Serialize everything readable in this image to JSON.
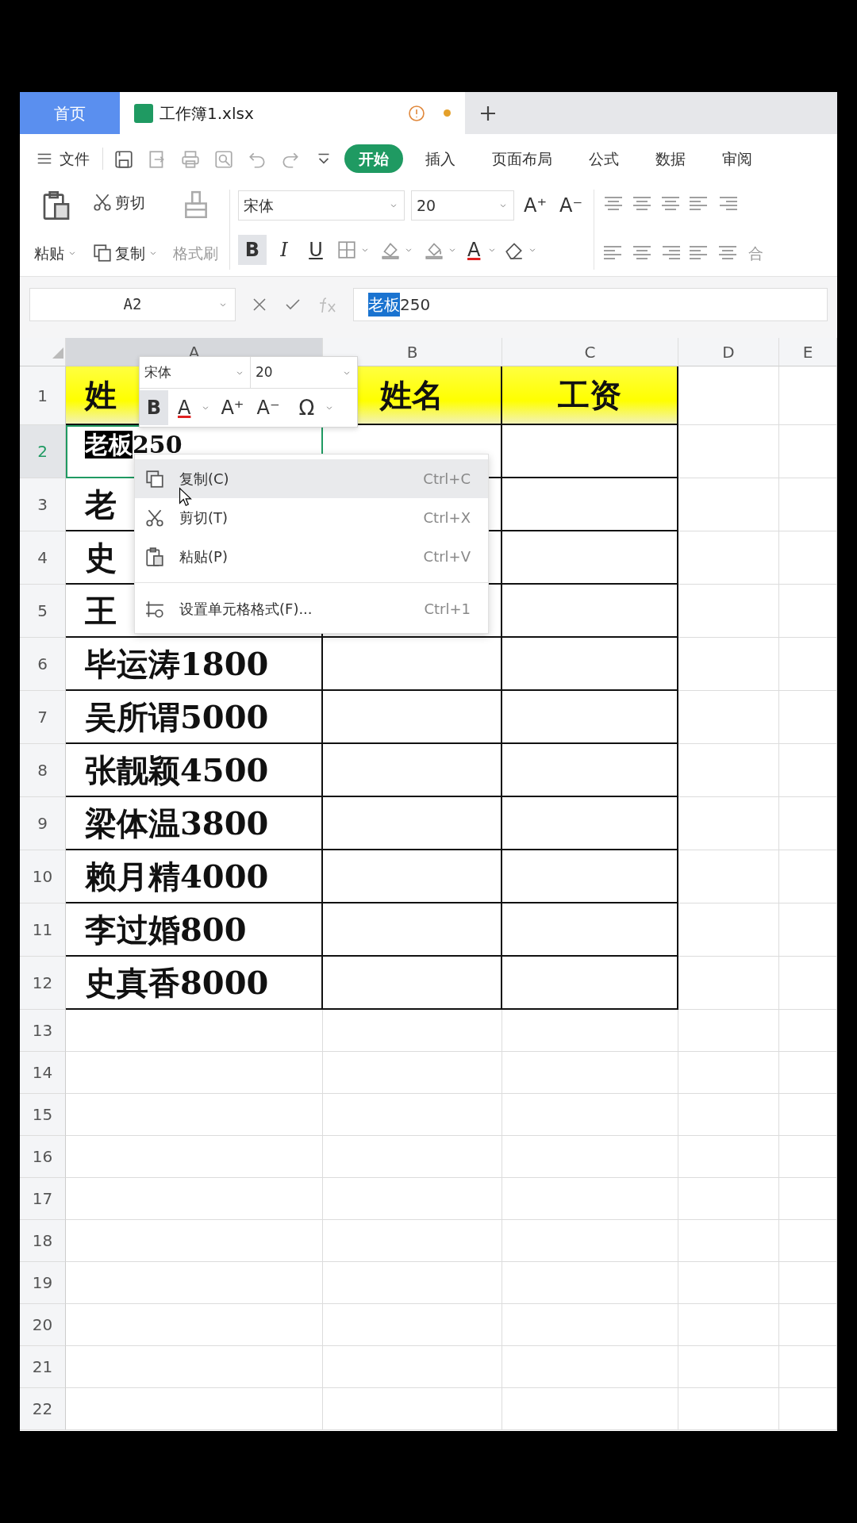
{
  "tabs": [
    {
      "label": "首页",
      "kind": "home",
      "selected": false
    },
    {
      "label": "工作簿1.xlsx",
      "kind": "file",
      "selected": true,
      "unsaved": true
    }
  ],
  "file_menu": "文件",
  "ribbon_tabs": [
    {
      "label": "开始",
      "selected": true
    },
    {
      "label": "插入",
      "selected": false
    },
    {
      "label": "页面布局",
      "selected": false
    },
    {
      "label": "公式",
      "selected": false
    },
    {
      "label": "数据",
      "selected": false
    },
    {
      "label": "审阅",
      "selected": false
    }
  ],
  "clipboard": {
    "paste": "粘贴",
    "cut": "剪切",
    "copy": "复制",
    "format_painter": "格式刷"
  },
  "font": {
    "name": "宋体",
    "size": "20",
    "grow": "A⁺",
    "shrink": "A⁻",
    "color_label": "A"
  },
  "format_buttons": [
    {
      "label": "B",
      "kind": "bold",
      "pressed": true
    },
    {
      "label": "I",
      "kind": "italic",
      "pressed": false
    },
    {
      "label": "U",
      "kind": "underline",
      "pressed": false
    }
  ],
  "merge_label": "合",
  "name_box": "A2",
  "formula": {
    "selected_text": "老板",
    "text": "250"
  },
  "columns": [
    {
      "label": "A",
      "selected": true
    },
    {
      "label": "B",
      "selected": false
    },
    {
      "label": "C",
      "selected": false
    },
    {
      "label": "D",
      "selected": false
    },
    {
      "label": "E",
      "selected": false
    }
  ],
  "rows": [
    {
      "number": "1",
      "selected": false,
      "header": true,
      "bordered": true,
      "cells": [
        {
          "text": "姓"
        },
        {
          "text": "姓名"
        },
        {
          "text": "工资"
        }
      ]
    },
    {
      "number": "2",
      "selected": true,
      "header": false,
      "bordered": true,
      "cells": [
        {
          "selected_text": "老板",
          "text": "250"
        }
      ]
    },
    {
      "number": "3",
      "selected": false,
      "header": false,
      "bordered": true,
      "cells": [
        {
          "text": "老"
        }
      ]
    },
    {
      "number": "4",
      "selected": false,
      "header": false,
      "bordered": true,
      "cells": [
        {
          "text": "史"
        }
      ]
    },
    {
      "number": "5",
      "selected": false,
      "header": false,
      "bordered": true,
      "cells": [
        {
          "text": "王"
        }
      ]
    },
    {
      "number": "6",
      "selected": false,
      "header": false,
      "bordered": true,
      "cells": [
        {
          "text": "毕运涛1800"
        }
      ]
    },
    {
      "number": "7",
      "selected": false,
      "header": false,
      "bordered": true,
      "cells": [
        {
          "text": "吴所谓5000"
        }
      ]
    },
    {
      "number": "8",
      "selected": false,
      "header": false,
      "bordered": true,
      "cells": [
        {
          "text": "张靓颖4500"
        }
      ]
    },
    {
      "number": "9",
      "selected": false,
      "header": false,
      "bordered": true,
      "cells": [
        {
          "text": "梁体温3800"
        }
      ]
    },
    {
      "number": "10",
      "selected": false,
      "header": false,
      "bordered": true,
      "cells": [
        {
          "text": "赖月精4000"
        }
      ]
    },
    {
      "number": "11",
      "selected": false,
      "header": false,
      "bordered": true,
      "cells": [
        {
          "text": "李过婚800"
        }
      ]
    },
    {
      "number": "12",
      "selected": false,
      "header": false,
      "bordered": true,
      "cells": [
        {
          "text": "史真香8000"
        }
      ]
    },
    {
      "number": "13",
      "selected": false,
      "header": false,
      "bordered": false,
      "cells": []
    },
    {
      "number": "14",
      "selected": false,
      "header": false,
      "bordered": false,
      "cells": []
    },
    {
      "number": "15",
      "selected": false,
      "header": false,
      "bordered": false,
      "cells": []
    },
    {
      "number": "16",
      "selected": false,
      "header": false,
      "bordered": false,
      "cells": []
    },
    {
      "number": "17",
      "selected": false,
      "header": false,
      "bordered": false,
      "cells": []
    },
    {
      "number": "18",
      "selected": false,
      "header": false,
      "bordered": false,
      "cells": []
    },
    {
      "number": "19",
      "selected": false,
      "header": false,
      "bordered": false,
      "cells": []
    },
    {
      "number": "20",
      "selected": false,
      "header": false,
      "bordered": false,
      "cells": []
    },
    {
      "number": "21",
      "selected": false,
      "header": false,
      "bordered": false,
      "cells": []
    },
    {
      "number": "22",
      "selected": false,
      "header": false,
      "bordered": false,
      "cells": []
    }
  ],
  "mini_toolbar": {
    "font": "宋体",
    "size": "20",
    "bold_label": "B",
    "bold": true,
    "color_label": "A",
    "grow": "A⁺",
    "shrink": "A⁻",
    "symbol": "Ω"
  },
  "context_menu": [
    {
      "kind": "copy",
      "label": "复制(C)",
      "shortcut": "Ctrl+C",
      "hover": true
    },
    {
      "kind": "cut",
      "label": "剪切(T)",
      "shortcut": "Ctrl+X",
      "hover": false
    },
    {
      "kind": "paste",
      "label": "粘贴(P)",
      "shortcut": "Ctrl+V",
      "hover": false
    },
    {
      "kind": "format",
      "label": "设置单元格格式(F)...",
      "shortcut": "Ctrl+1",
      "hover": false
    }
  ]
}
